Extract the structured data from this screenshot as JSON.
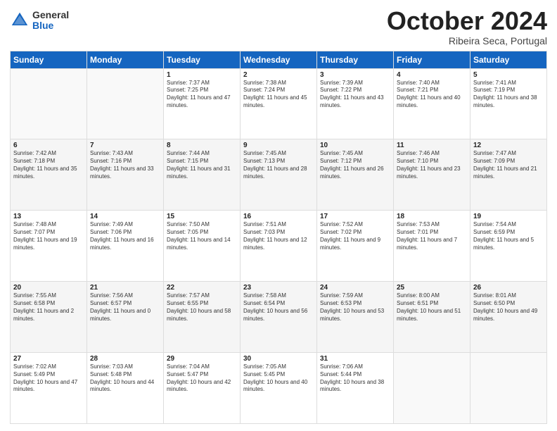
{
  "header": {
    "logo_general": "General",
    "logo_blue": "Blue",
    "month": "October 2024",
    "location": "Ribeira Seca, Portugal"
  },
  "days_of_week": [
    "Sunday",
    "Monday",
    "Tuesday",
    "Wednesday",
    "Thursday",
    "Friday",
    "Saturday"
  ],
  "weeks": [
    [
      {
        "day": "",
        "info": ""
      },
      {
        "day": "",
        "info": ""
      },
      {
        "day": "1",
        "info": "Sunrise: 7:37 AM\nSunset: 7:25 PM\nDaylight: 11 hours and 47 minutes."
      },
      {
        "day": "2",
        "info": "Sunrise: 7:38 AM\nSunset: 7:24 PM\nDaylight: 11 hours and 45 minutes."
      },
      {
        "day": "3",
        "info": "Sunrise: 7:39 AM\nSunset: 7:22 PM\nDaylight: 11 hours and 43 minutes."
      },
      {
        "day": "4",
        "info": "Sunrise: 7:40 AM\nSunset: 7:21 PM\nDaylight: 11 hours and 40 minutes."
      },
      {
        "day": "5",
        "info": "Sunrise: 7:41 AM\nSunset: 7:19 PM\nDaylight: 11 hours and 38 minutes."
      }
    ],
    [
      {
        "day": "6",
        "info": "Sunrise: 7:42 AM\nSunset: 7:18 PM\nDaylight: 11 hours and 35 minutes."
      },
      {
        "day": "7",
        "info": "Sunrise: 7:43 AM\nSunset: 7:16 PM\nDaylight: 11 hours and 33 minutes."
      },
      {
        "day": "8",
        "info": "Sunrise: 7:44 AM\nSunset: 7:15 PM\nDaylight: 11 hours and 31 minutes."
      },
      {
        "day": "9",
        "info": "Sunrise: 7:45 AM\nSunset: 7:13 PM\nDaylight: 11 hours and 28 minutes."
      },
      {
        "day": "10",
        "info": "Sunrise: 7:45 AM\nSunset: 7:12 PM\nDaylight: 11 hours and 26 minutes."
      },
      {
        "day": "11",
        "info": "Sunrise: 7:46 AM\nSunset: 7:10 PM\nDaylight: 11 hours and 23 minutes."
      },
      {
        "day": "12",
        "info": "Sunrise: 7:47 AM\nSunset: 7:09 PM\nDaylight: 11 hours and 21 minutes."
      }
    ],
    [
      {
        "day": "13",
        "info": "Sunrise: 7:48 AM\nSunset: 7:07 PM\nDaylight: 11 hours and 19 minutes."
      },
      {
        "day": "14",
        "info": "Sunrise: 7:49 AM\nSunset: 7:06 PM\nDaylight: 11 hours and 16 minutes."
      },
      {
        "day": "15",
        "info": "Sunrise: 7:50 AM\nSunset: 7:05 PM\nDaylight: 11 hours and 14 minutes."
      },
      {
        "day": "16",
        "info": "Sunrise: 7:51 AM\nSunset: 7:03 PM\nDaylight: 11 hours and 12 minutes."
      },
      {
        "day": "17",
        "info": "Sunrise: 7:52 AM\nSunset: 7:02 PM\nDaylight: 11 hours and 9 minutes."
      },
      {
        "day": "18",
        "info": "Sunrise: 7:53 AM\nSunset: 7:01 PM\nDaylight: 11 hours and 7 minutes."
      },
      {
        "day": "19",
        "info": "Sunrise: 7:54 AM\nSunset: 6:59 PM\nDaylight: 11 hours and 5 minutes."
      }
    ],
    [
      {
        "day": "20",
        "info": "Sunrise: 7:55 AM\nSunset: 6:58 PM\nDaylight: 11 hours and 2 minutes."
      },
      {
        "day": "21",
        "info": "Sunrise: 7:56 AM\nSunset: 6:57 PM\nDaylight: 11 hours and 0 minutes."
      },
      {
        "day": "22",
        "info": "Sunrise: 7:57 AM\nSunset: 6:55 PM\nDaylight: 10 hours and 58 minutes."
      },
      {
        "day": "23",
        "info": "Sunrise: 7:58 AM\nSunset: 6:54 PM\nDaylight: 10 hours and 56 minutes."
      },
      {
        "day": "24",
        "info": "Sunrise: 7:59 AM\nSunset: 6:53 PM\nDaylight: 10 hours and 53 minutes."
      },
      {
        "day": "25",
        "info": "Sunrise: 8:00 AM\nSunset: 6:51 PM\nDaylight: 10 hours and 51 minutes."
      },
      {
        "day": "26",
        "info": "Sunrise: 8:01 AM\nSunset: 6:50 PM\nDaylight: 10 hours and 49 minutes."
      }
    ],
    [
      {
        "day": "27",
        "info": "Sunrise: 7:02 AM\nSunset: 5:49 PM\nDaylight: 10 hours and 47 minutes."
      },
      {
        "day": "28",
        "info": "Sunrise: 7:03 AM\nSunset: 5:48 PM\nDaylight: 10 hours and 44 minutes."
      },
      {
        "day": "29",
        "info": "Sunrise: 7:04 AM\nSunset: 5:47 PM\nDaylight: 10 hours and 42 minutes."
      },
      {
        "day": "30",
        "info": "Sunrise: 7:05 AM\nSunset: 5:45 PM\nDaylight: 10 hours and 40 minutes."
      },
      {
        "day": "31",
        "info": "Sunrise: 7:06 AM\nSunset: 5:44 PM\nDaylight: 10 hours and 38 minutes."
      },
      {
        "day": "",
        "info": ""
      },
      {
        "day": "",
        "info": ""
      }
    ]
  ]
}
